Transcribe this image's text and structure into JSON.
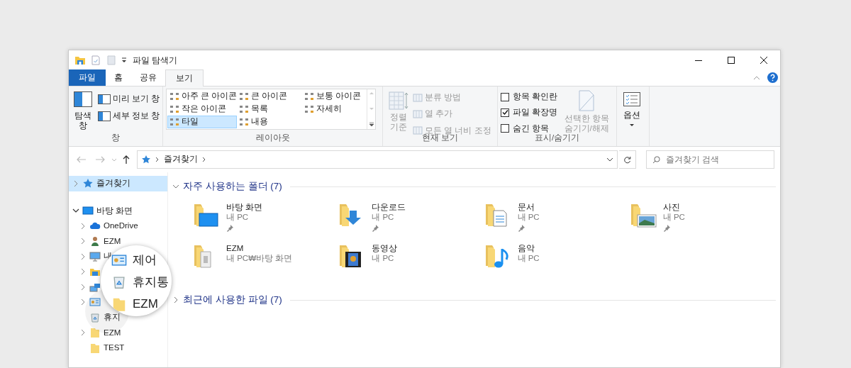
{
  "window": {
    "title": "파일 탐색기"
  },
  "tabs": [
    {
      "label": "파일",
      "kind": "file",
      "selected": false
    },
    {
      "label": "홈",
      "kind": "tab",
      "selected": false
    },
    {
      "label": "공유",
      "kind": "tab",
      "selected": false
    },
    {
      "label": "보기",
      "kind": "tab",
      "selected": true
    }
  ],
  "ribbon": {
    "groups": [
      {
        "kind": "panes",
        "label": "창",
        "big": "탐색 창",
        "items": [
          "미리 보기 창",
          "세부 정보 창"
        ]
      },
      {
        "kind": "layout",
        "label": "레이아웃",
        "items": [
          {
            "label": "아주 큰 아이콘",
            "selected": false
          },
          {
            "label": "큰 아이콘",
            "selected": false
          },
          {
            "label": "보통 아이콘",
            "selected": false
          },
          {
            "label": "작은 아이콘",
            "selected": false
          },
          {
            "label": "목록",
            "selected": false
          },
          {
            "label": "자세히",
            "selected": false
          },
          {
            "label": "타일",
            "selected": true
          },
          {
            "label": "내용",
            "selected": false
          }
        ]
      },
      {
        "kind": "current_view",
        "label": "현재 보기",
        "big": "정렬 기준",
        "items": [
          {
            "label": "분류 방법",
            "disabled": true
          },
          {
            "label": "열 추가",
            "disabled": true
          },
          {
            "label": "모든 열 너비 조정",
            "disabled": true
          }
        ]
      },
      {
        "kind": "show_hide",
        "label": "표시/숨기기",
        "checks": [
          {
            "label": "항목 확인란",
            "checked": false
          },
          {
            "label": "파일 확장명",
            "checked": true
          },
          {
            "label": "숨긴 항목",
            "checked": false
          }
        ],
        "big": "선택한 항목 숨기기/해제"
      },
      {
        "kind": "options",
        "big": "옵션"
      }
    ]
  },
  "address": {
    "path": "즐겨찾기"
  },
  "search": {
    "placeholder": "즐겨찾기 검색"
  },
  "sidebar": {
    "items": [
      {
        "kind": "star",
        "label": "즐겨찾기",
        "selected": true,
        "expanded": false
      },
      {
        "kind": "desktop",
        "label": "바탕 화면",
        "selected": false,
        "expanded": true,
        "children": [
          {
            "kind": "cloud",
            "label": "OneDrive",
            "selected": false,
            "expanded": false
          },
          {
            "kind": "user",
            "label": "EZM",
            "selected": false,
            "expanded": false
          },
          {
            "kind": "pc",
            "label": "내",
            "selected": false,
            "expanded": false
          },
          {
            "kind": "libraries",
            "selected": false,
            "expanded": false
          },
          {
            "kind": "network",
            "selected": false,
            "expanded": false
          },
          {
            "kind": "control",
            "selected": false,
            "expanded": false
          },
          {
            "kind": "recycle",
            "label": "휴지",
            "selected": false
          },
          {
            "kind": "folder",
            "label": "EZM",
            "selected": false,
            "expanded": false
          },
          {
            "kind": "folder",
            "label": "TEST",
            "selected": false
          }
        ]
      }
    ]
  },
  "magnifier": {
    "items": [
      {
        "kind": "control",
        "label": "제어"
      },
      {
        "kind": "recycle",
        "label": "휴지통"
      },
      {
        "kind": "folder",
        "label": "EZM"
      }
    ]
  },
  "sections": [
    {
      "title": "자주 사용하는 폴더 (7)",
      "expanded": true,
      "items": [
        {
          "kind": "desktop",
          "name": "바탕 화면",
          "location": "내 PC",
          "pinned": true
        },
        {
          "kind": "download",
          "name": "다운로드",
          "location": "내 PC",
          "pinned": true
        },
        {
          "kind": "document",
          "name": "문서",
          "location": "내 PC",
          "pinned": true
        },
        {
          "kind": "picture",
          "name": "사진",
          "location": "내 PC",
          "pinned": true
        },
        {
          "kind": "files",
          "name": "EZM",
          "location": "내 PC₩바탕 화면",
          "pinned": false
        },
        {
          "kind": "video",
          "name": "동영상",
          "location": "내 PC",
          "pinned": false
        },
        {
          "kind": "music",
          "name": "음악",
          "location": "내 PC",
          "pinned": false
        }
      ]
    },
    {
      "title": "최근에 사용한 파일 (7)",
      "expanded": false
    }
  ]
}
